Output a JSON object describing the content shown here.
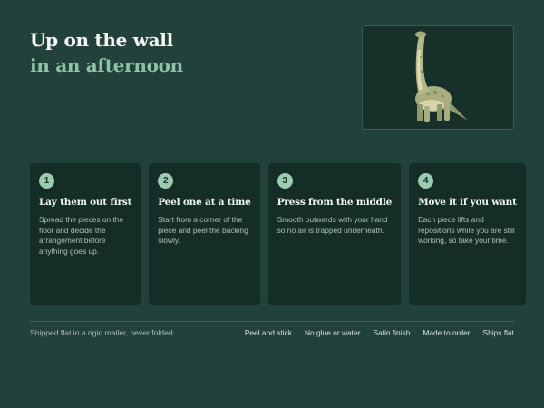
{
  "header": {
    "title_line1": "Up on the wall",
    "title_line2": "in an afternoon"
  },
  "hero": {
    "icon": "brachiosaurus-illustration"
  },
  "steps": [
    {
      "number": "1",
      "title": "Lay them out first",
      "body": "Spread the pieces on the floor and decide the arrangement before anything goes up."
    },
    {
      "number": "2",
      "title": "Peel one at a time",
      "body": "Start from a corner of the piece and peel the backing slowly."
    },
    {
      "number": "3",
      "title": "Press from the middle",
      "body": "Smooth outwards with your hand so no air is trapped underneath."
    },
    {
      "number": "4",
      "title": "Move it if you want",
      "body": "Each piece lifts and repositions while you are still working, so take your time."
    }
  ],
  "footer": {
    "note": "Shipped flat in a rigid mailer, never folded.",
    "tags": [
      "Peel and stick",
      "No glue or water",
      "Satin finish",
      "Made to order",
      "Ships flat"
    ]
  },
  "colors": {
    "background": "#22413a",
    "card": "#152d27",
    "accent": "#8fc3a8",
    "badge": "#9ccbb2"
  }
}
